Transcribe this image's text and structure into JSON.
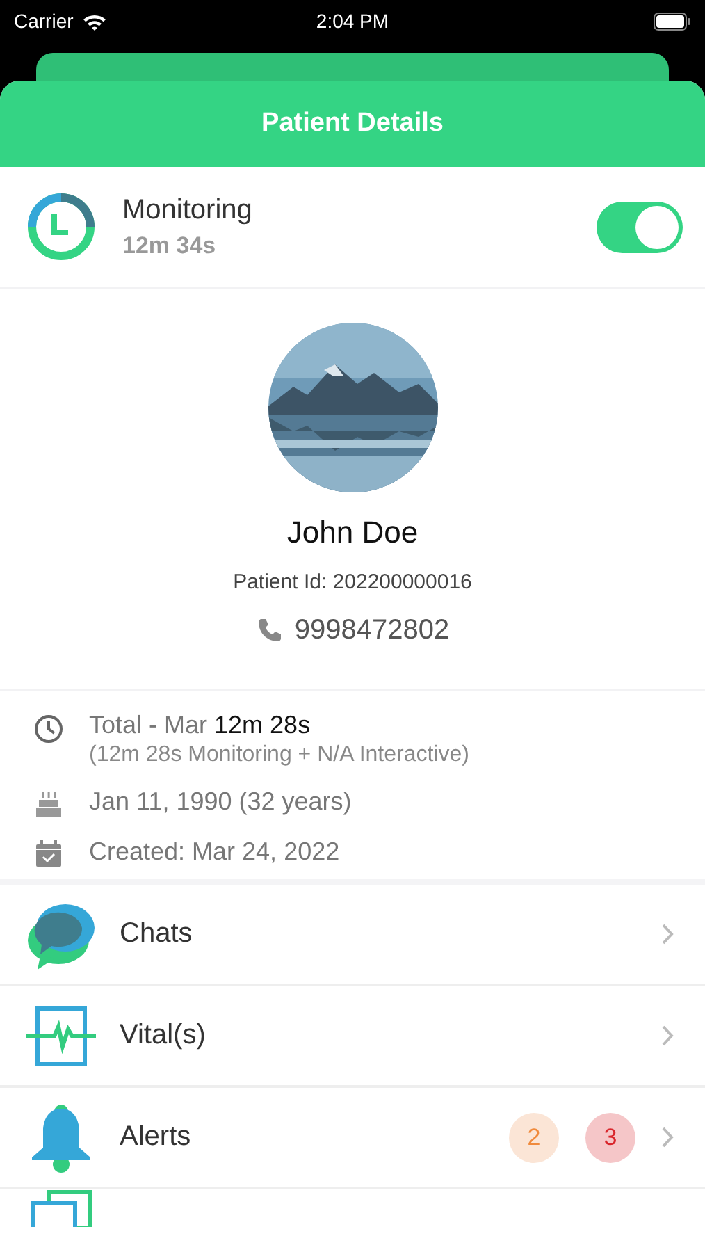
{
  "status_bar": {
    "carrier": "Carrier",
    "time": "2:04 PM"
  },
  "header": {
    "title": "Patient Details"
  },
  "monitoring": {
    "label": "Monitoring",
    "duration": "12m 34s",
    "on": true
  },
  "patient": {
    "name": "John Doe",
    "patient_id": "Patient Id: 202200000016",
    "phone": "9998472802"
  },
  "info": [
    {
      "kind": "clock",
      "text": "Total - Mar **12m 28s**",
      "subtext": "(12m 28s Monitoring + N/A Interactive)"
    },
    {
      "kind": "cake",
      "text": "Jan 11, 1990 (32 years)"
    },
    {
      "kind": "calendar",
      "text": "Created: Mar 24, 2022"
    }
  ],
  "menu": [
    {
      "kind": "chats",
      "label": "Chats"
    },
    {
      "kind": "vitals",
      "label": "Vital(s)"
    },
    {
      "kind": "alerts",
      "label": "Alerts",
      "badges": [
        {
          "count": "2",
          "color": "#fbe5d6"
        },
        {
          "count": "3",
          "color": "#f5c6c8"
        }
      ]
    },
    {
      "kind": "screens"
    }
  ]
}
